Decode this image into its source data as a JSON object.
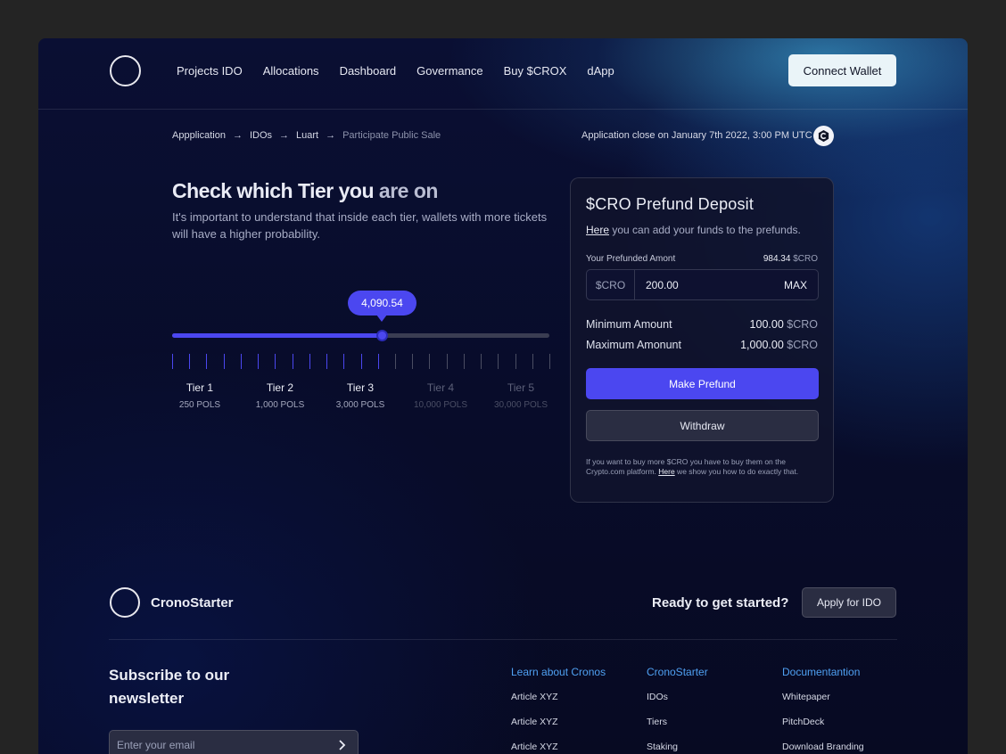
{
  "header": {
    "nav": [
      "Projects IDO",
      "Allocations",
      "Dashboard",
      "Govermance",
      "Buy $CROX",
      "dApp"
    ],
    "connect_label": "Connect Wallet"
  },
  "breadcrumb": {
    "items": [
      "Appplication",
      "IDOs",
      "Luart"
    ],
    "current": "Participate Public Sale",
    "separator": "→"
  },
  "application_close": "Application close on January 7th 2022, 3:00 PM UTC",
  "tiers_section": {
    "title_main": "Check which Tier you",
    "title_muted": "are on",
    "subtitle": "It's important to understand that inside each tier, wallets with more tickets will have a higher probability.",
    "slider_value": "4,090.54",
    "slider_fraction": 0.557,
    "tiers": [
      {
        "name": "Tier 1",
        "amount": "250 POLS",
        "active": true
      },
      {
        "name": "Tier 2",
        "amount": "1,000 POLS",
        "active": true
      },
      {
        "name": "Tier 3",
        "amount": "3,000 POLS",
        "active": true
      },
      {
        "name": "Tier 4",
        "amount": "10,000 POLS",
        "active": false
      },
      {
        "name": "Tier 5",
        "amount": "30,000 POLS",
        "active": false
      }
    ]
  },
  "deposit_card": {
    "title": "$CRO Prefund Deposit",
    "subtitle_link": "Here",
    "subtitle_rest": " you can add your funds to the prefunds.",
    "prefunded_label": "Your Prefunded Amont",
    "prefunded_value": "984.34",
    "currency": "$CRO",
    "input_prefix": "$CRO",
    "input_value": "200.00",
    "max_label": "MAX",
    "min_label": "Minimum Amount",
    "min_value": "100.00",
    "max_amount_label": "Maximum Amonunt",
    "max_amount_value": "1,000.00",
    "primary_button": "Make Prefund",
    "secondary_button": "Withdraw",
    "note_pre": "If you want to buy more $CRO you have to buy them on the Crypto.com platform. ",
    "note_link": "Here",
    "note_post": " we show you how to do exactly that."
  },
  "footer": {
    "brand": "CronoStarter",
    "cta_text": "Ready to get started?",
    "cta_button": "Apply for IDO",
    "newsletter_title": "Subscribe to our newsletter",
    "email_placeholder": "Enter your email",
    "columns": [
      {
        "heading": "Learn about Cronos",
        "links": [
          "Article XYZ",
          "Article XYZ",
          "Article XYZ"
        ]
      },
      {
        "heading": "CronoStarter",
        "links": [
          "IDOs",
          "Tiers",
          "Staking"
        ]
      },
      {
        "heading": "Documentantion",
        "links": [
          "Whitepaper",
          "PitchDeck",
          "Download Branding"
        ]
      }
    ]
  },
  "colors": {
    "accent": "#4b47f0",
    "link_blue": "#4fa0f2",
    "background": "#080c2a"
  },
  "icons": [
    "logo-ring-icon",
    "arrow-right-icon",
    "cronos-logo-icon",
    "chevron-right-icon"
  ]
}
